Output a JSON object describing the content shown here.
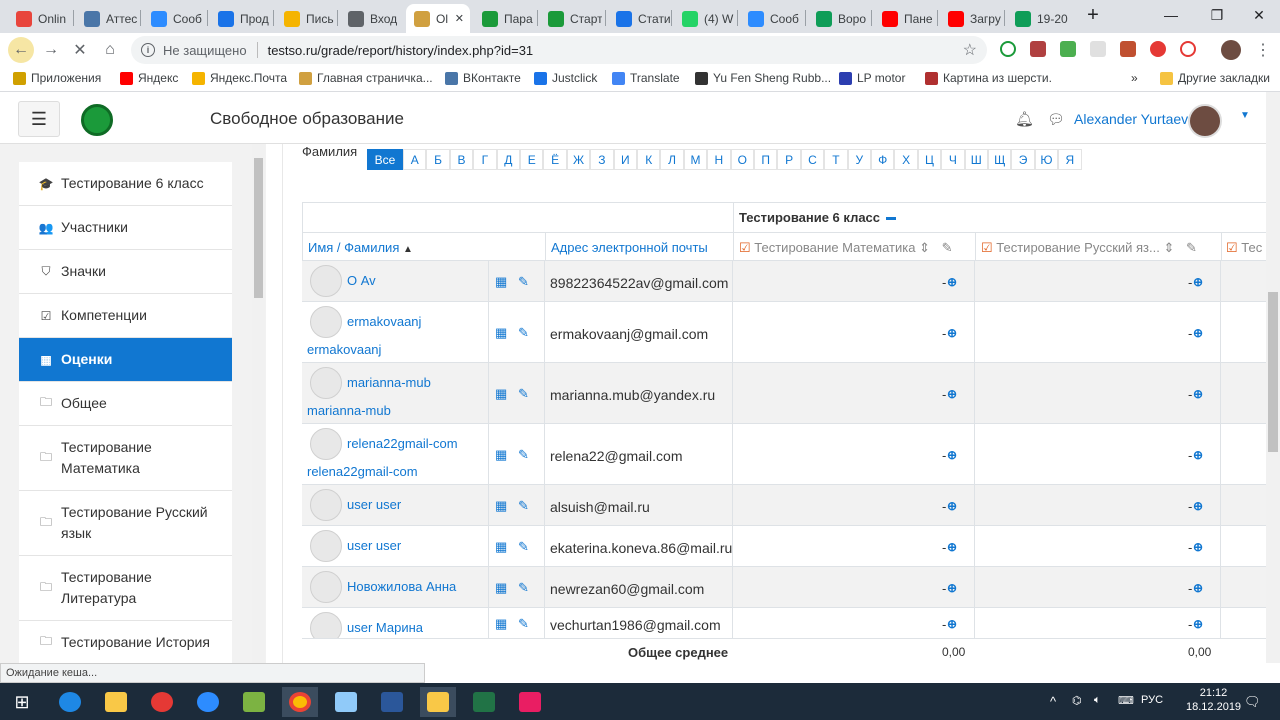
{
  "tabs": [
    {
      "label": "Onlin",
      "color": "#e8453c"
    },
    {
      "label": "Аттес",
      "color": "#4a76a8"
    },
    {
      "label": "Сооб",
      "color": "#2d8cff"
    },
    {
      "label": "Прод",
      "color": "#1a73e8"
    },
    {
      "label": "Пись",
      "color": "#f5b400"
    },
    {
      "label": "Вход",
      "color": "#5f6368"
    },
    {
      "label": "Ol",
      "color": "#d0a040"
    },
    {
      "label": "Пара",
      "color": "#1b9a3a"
    },
    {
      "label": "Старт",
      "color": "#1b9a3a"
    },
    {
      "label": "Стати",
      "color": "#1a73e8"
    },
    {
      "label": "(4) W",
      "color": "#25d366"
    },
    {
      "label": "Сооб",
      "color": "#2d8cff"
    },
    {
      "label": "Воро",
      "color": "#0f9d58"
    },
    {
      "label": "Пане",
      "color": "#ff0000"
    },
    {
      "label": "Загру",
      "color": "#ff0000"
    },
    {
      "label": "19-20",
      "color": "#0f9d58"
    }
  ],
  "toolbar": {
    "security": "Не защищено",
    "url": "testso.ru/grade/report/history/index.php?id=31"
  },
  "bookmarks": [
    {
      "label": "Приложения",
      "color": "#d0a000"
    },
    {
      "label": "Яндекс",
      "color": "#ff0000"
    },
    {
      "label": "Яндекс.Почта",
      "color": "#f5b400"
    },
    {
      "label": "Главная страничка...",
      "color": "#d0a040"
    },
    {
      "label": "ВКонтакте",
      "color": "#4a76a8"
    },
    {
      "label": "Justclick",
      "color": "#1a73e8"
    },
    {
      "label": "Translate",
      "color": "#4285f4"
    },
    {
      "label": "Yu Fen Sheng Rubb...",
      "color": "#333333"
    },
    {
      "label": "LP motor",
      "color": "#2c3eb0"
    },
    {
      "label": "Картина из шерсти.",
      "color": "#b03030"
    }
  ],
  "bookmarks_other": "Другие закладки",
  "site": {
    "name": "Свободное образование",
    "user": "Alexander Yurtaev"
  },
  "drawer": [
    {
      "label": "Тестирование 6 класс",
      "icon": "🎓"
    },
    {
      "label": "Участники",
      "icon": "👥"
    },
    {
      "label": "Значки",
      "icon": "⛉"
    },
    {
      "label": "Компетенции",
      "icon": "☑"
    },
    {
      "label": "Оценки",
      "icon": "▦",
      "active": true
    },
    {
      "label": "Общее",
      "icon": "🗀"
    },
    {
      "label": "Тестирование Математика",
      "icon": "🗀"
    },
    {
      "label": "Тестирование Русский язык",
      "icon": "🗀"
    },
    {
      "label": "Тестирование Литература",
      "icon": "🗀"
    },
    {
      "label": "Тестирование История",
      "icon": "🗀"
    }
  ],
  "filter": {
    "label": "Фамилия",
    "letters": [
      "Все",
      "А",
      "Б",
      "В",
      "Г",
      "Д",
      "Е",
      "Ё",
      "Ж",
      "З",
      "И",
      "К",
      "Л",
      "М",
      "Н",
      "О",
      "П",
      "Р",
      "С",
      "Т",
      "У",
      "Ф",
      "Х",
      "Ц",
      "Ч",
      "Ш",
      "Щ",
      "Э",
      "Ю",
      "Я"
    ]
  },
  "table": {
    "course_header": "Тестирование 6 класс",
    "col_name": "Имя / Фамилия",
    "col_email": "Адрес электронной почты",
    "col_math": "Тестирование Математика",
    "col_rus": "Тестирование Русский яз...",
    "col_next": "Тес",
    "rows": [
      {
        "name1": "О Av",
        "name2": "",
        "email": "89822364522av@gmail.com",
        "g1": "-",
        "g2": "-"
      },
      {
        "name1": "ermakovaanj",
        "name2": "ermakovaanj",
        "email": "ermakovaanj@gmail.com",
        "g1": "-",
        "g2": "-"
      },
      {
        "name1": "marianna-mub",
        "name2": "marianna-mub",
        "email": "marianna.mub@yandex.ru",
        "g1": "-",
        "g2": "-"
      },
      {
        "name1": "relena22gmail-com",
        "name2": "relena22gmail-com",
        "email": "relena22@gmail.com",
        "g1": "-",
        "g2": "-"
      },
      {
        "name1": "user user",
        "name2": "",
        "email": "alsuish@mail.ru",
        "g1": "-",
        "g2": "-"
      },
      {
        "name1": "user user",
        "name2": "",
        "email": "ekaterina.koneva.86@mail.ru",
        "g1": "-",
        "g2": "-"
      },
      {
        "name1": "Новожилова Анна",
        "name2": "",
        "email": "newrezan60@gmail.com",
        "g1": "-",
        "g2": "-"
      },
      {
        "name1": "user Марина",
        "name2": "",
        "email": "vechurtan1986@gmail.com",
        "g1": "-",
        "g2": "-"
      }
    ],
    "avg_label": "Общее среднее",
    "avg_math": "0,00",
    "avg_rus": "0,00"
  },
  "status": "Ожидание кеша...",
  "tray": {
    "lang": "РУС",
    "time": "21:12",
    "date": "18.12.2019"
  }
}
